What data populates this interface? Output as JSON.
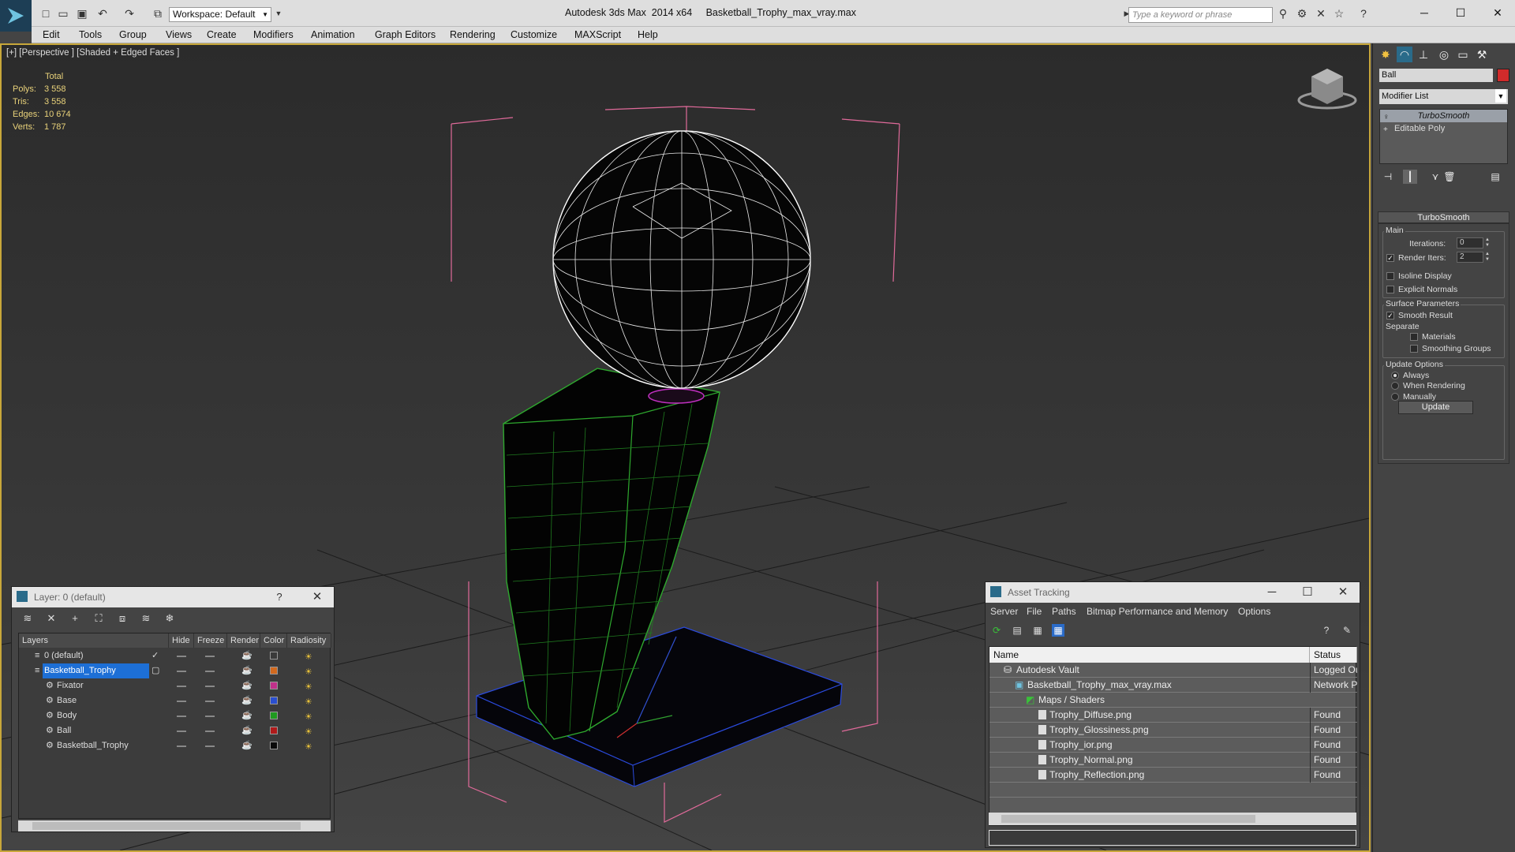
{
  "titlebar": {
    "workspace": "Workspace: Default",
    "app_title": "Autodesk 3ds Max  2014 x64",
    "file_name": "Basketball_Trophy_max_vray.max",
    "search_placeholder": "Type a keyword or phrase"
  },
  "menu": [
    "Edit",
    "Tools",
    "Group",
    "Views",
    "Create",
    "Modifiers",
    "Animation",
    "Graph Editors",
    "Rendering",
    "Customize",
    "MAXScript",
    "Help"
  ],
  "viewport": {
    "label": "[+] [Perspective ] [Shaded + Edged Faces ]",
    "stats_header": "Total",
    "stats": [
      {
        "k": "Polys:",
        "v": "3 558"
      },
      {
        "k": "Tris:",
        "v": "3 558"
      },
      {
        "k": "Edges:",
        "v": "10 674"
      },
      {
        "k": "Verts:",
        "v": "1 787"
      }
    ]
  },
  "command_panel": {
    "object_name": "Ball",
    "object_color": "#d12b2b",
    "modifier_list": "Modifier List",
    "stack": [
      "TurboSmooth",
      "Editable Poly"
    ],
    "rollout_title": "TurboSmooth",
    "main_group": "Main",
    "iterations_label": "Iterations:",
    "iterations_value": "0",
    "render_iters_label": "Render Iters:",
    "render_iters_value": "2",
    "isoline_label": "Isoline Display",
    "explicit_normals_label": "Explicit Normals",
    "surface_group": "Surface Parameters",
    "smooth_result_label": "Smooth Result",
    "separate_label": "Separate",
    "materials_label": "Materials",
    "smoothing_groups_label": "Smoothing Groups",
    "update_group": "Update Options",
    "always_label": "Always",
    "when_rendering_label": "When Rendering",
    "manually_label": "Manually",
    "update_button": "Update"
  },
  "layer_window": {
    "title": "Layer: 0 (default)",
    "help": "?",
    "columns": [
      "Layers",
      "Hide",
      "Freeze",
      "Render",
      "Color",
      "Radiosity"
    ],
    "rows": [
      {
        "name": "0 (default)",
        "color": "#3a3a3a"
      },
      {
        "name": "Basketball_Trophy",
        "color": "#d2691e"
      },
      {
        "name": "Fixator",
        "color": "#c0308a"
      },
      {
        "name": "Base",
        "color": "#2a4fd0"
      },
      {
        "name": "Body",
        "color": "#1f9a1f"
      },
      {
        "name": "Ball",
        "color": "#b01a1a"
      },
      {
        "name": "Basketball_Trophy",
        "color": "#0a0a0a"
      }
    ]
  },
  "asset_window": {
    "title": "Asset Tracking",
    "menu": [
      "Server",
      "File",
      "Paths",
      "Bitmap Performance and Memory",
      "Options"
    ],
    "columns": [
      "Name",
      "Status"
    ],
    "rows": [
      {
        "name": "Autodesk Vault",
        "status": "Logged Ou"
      },
      {
        "name": "Basketball_Trophy_max_vray.max",
        "status": "Network P"
      },
      {
        "name": "Maps / Shaders",
        "status": ""
      },
      {
        "name": "Trophy_Diffuse.png",
        "status": "Found"
      },
      {
        "name": "Trophy_Glossiness.png",
        "status": "Found"
      },
      {
        "name": "Trophy_ior.png",
        "status": "Found"
      },
      {
        "name": "Trophy_Normal.png",
        "status": "Found"
      },
      {
        "name": "Trophy_Reflection.png",
        "status": "Found"
      }
    ]
  }
}
